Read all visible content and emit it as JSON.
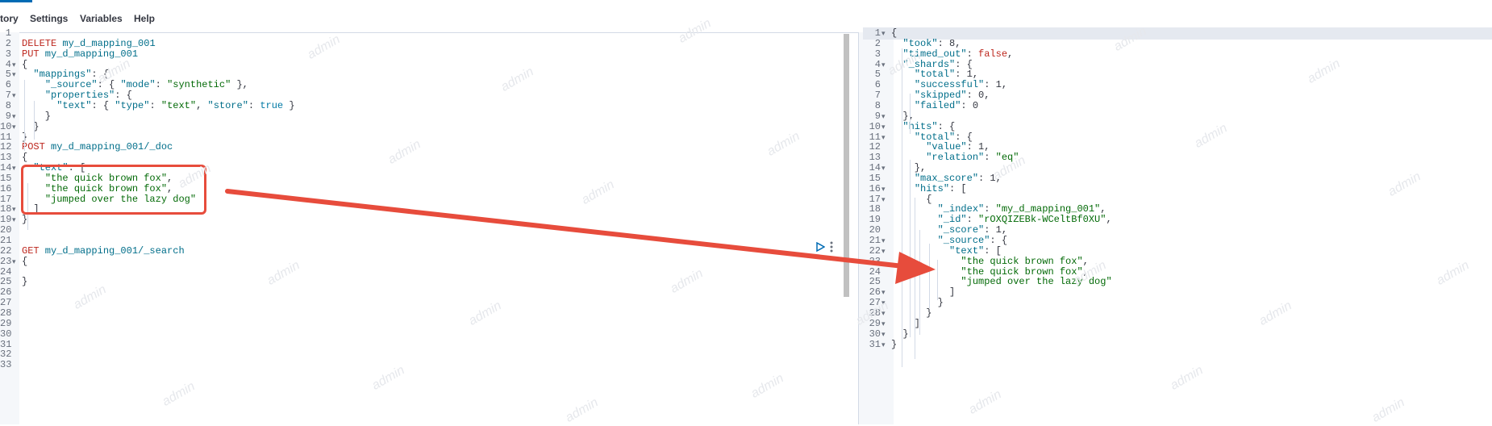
{
  "menu": {
    "history_label": "tory",
    "settings_label": "Settings",
    "variables_label": "Variables",
    "help_label": "Help"
  },
  "watermark_text": "admin",
  "request_editor": {
    "line_numbers": [
      "1",
      "2",
      "3",
      "4",
      "5",
      "6",
      "7",
      "8",
      "9",
      "10",
      "11",
      "12",
      "13",
      "14",
      "15",
      "16",
      "17",
      "18",
      "19",
      "20",
      "21",
      "22",
      "23",
      "24",
      "25",
      "26",
      "27",
      "28",
      "29",
      "30",
      "31",
      "32",
      "33"
    ],
    "fold_lines": [
      4,
      5,
      7,
      9,
      10,
      14,
      18,
      19,
      23
    ],
    "lines": [
      [],
      [
        {
          "t": "DELETE",
          "c": "kw"
        },
        {
          "t": " my_d_mapping_001",
          "c": "url"
        }
      ],
      [
        {
          "t": "PUT",
          "c": "kw"
        },
        {
          "t": " my_d_mapping_001",
          "c": "url"
        }
      ],
      [
        {
          "t": "{",
          "c": ""
        }
      ],
      [
        {
          "t": "  ",
          "c": ""
        },
        {
          "t": "\"mappings\"",
          "c": "key"
        },
        {
          "t": ": {",
          "c": ""
        }
      ],
      [
        {
          "t": "    ",
          "c": ""
        },
        {
          "t": "\"_source\"",
          "c": "key"
        },
        {
          "t": ": { ",
          "c": ""
        },
        {
          "t": "\"mode\"",
          "c": "key"
        },
        {
          "t": ": ",
          "c": ""
        },
        {
          "t": "\"synthetic\"",
          "c": "str"
        },
        {
          "t": " },",
          "c": ""
        }
      ],
      [
        {
          "t": "    ",
          "c": ""
        },
        {
          "t": "\"properties\"",
          "c": "key"
        },
        {
          "t": ": {",
          "c": ""
        }
      ],
      [
        {
          "t": "      ",
          "c": ""
        },
        {
          "t": "\"text\"",
          "c": "key"
        },
        {
          "t": ": { ",
          "c": ""
        },
        {
          "t": "\"type\"",
          "c": "key"
        },
        {
          "t": ": ",
          "c": ""
        },
        {
          "t": "\"text\"",
          "c": "str"
        },
        {
          "t": ", ",
          "c": ""
        },
        {
          "t": "\"store\"",
          "c": "key"
        },
        {
          "t": ": ",
          "c": ""
        },
        {
          "t": "true",
          "c": "lit"
        },
        {
          "t": " }",
          "c": ""
        }
      ],
      [
        {
          "t": "    }",
          "c": ""
        }
      ],
      [
        {
          "t": "  }",
          "c": ""
        }
      ],
      [
        {
          "t": "}",
          "c": ""
        }
      ],
      [
        {
          "t": "POST",
          "c": "kw"
        },
        {
          "t": " my_d_mapping_001/_doc",
          "c": "url"
        }
      ],
      [
        {
          "t": "{",
          "c": ""
        }
      ],
      [
        {
          "t": "  ",
          "c": ""
        },
        {
          "t": "\"text\"",
          "c": "key"
        },
        {
          "t": ": [",
          "c": ""
        }
      ],
      [
        {
          "t": "    ",
          "c": ""
        },
        {
          "t": "\"the quick brown fox\"",
          "c": "str"
        },
        {
          "t": ",",
          "c": ""
        }
      ],
      [
        {
          "t": "    ",
          "c": ""
        },
        {
          "t": "\"the quick brown fox\"",
          "c": "str"
        },
        {
          "t": ",",
          "c": ""
        }
      ],
      [
        {
          "t": "    ",
          "c": ""
        },
        {
          "t": "\"jumped over the lazy dog\"",
          "c": "str"
        }
      ],
      [
        {
          "t": "  ]",
          "c": ""
        }
      ],
      [
        {
          "t": "}",
          "c": ""
        }
      ],
      [],
      [],
      [
        {
          "t": "GET",
          "c": "kw"
        },
        {
          "t": " my_d_mapping_001/_search",
          "c": "url"
        }
      ],
      [
        {
          "t": "{",
          "c": ""
        }
      ],
      [],
      [
        {
          "t": "}",
          "c": ""
        }
      ],
      [],
      [],
      [],
      [],
      [],
      [],
      [],
      []
    ]
  },
  "response_editor": {
    "line_numbers": [
      "1",
      "2",
      "3",
      "4",
      "5",
      "6",
      "7",
      "8",
      "9",
      "10",
      "11",
      "12",
      "13",
      "14",
      "15",
      "16",
      "17",
      "18",
      "19",
      "20",
      "21",
      "22",
      "23",
      "24",
      "25",
      "26",
      "27",
      "28",
      "29",
      "30",
      "31"
    ],
    "fold_lines": [
      1,
      4,
      9,
      10,
      11,
      14,
      16,
      17,
      21,
      22,
      26,
      27,
      28,
      29,
      30,
      31
    ],
    "lines": [
      [
        {
          "t": "{",
          "c": ""
        }
      ],
      [
        {
          "t": "  ",
          "c": ""
        },
        {
          "t": "\"took\"",
          "c": "key"
        },
        {
          "t": ": ",
          "c": ""
        },
        {
          "t": "8",
          "c": "num"
        },
        {
          "t": ",",
          "c": ""
        }
      ],
      [
        {
          "t": "  ",
          "c": ""
        },
        {
          "t": "\"timed_out\"",
          "c": "key"
        },
        {
          "t": ": ",
          "c": ""
        },
        {
          "t": "false",
          "c": "kw"
        },
        {
          "t": ",",
          "c": ""
        }
      ],
      [
        {
          "t": "  ",
          "c": ""
        },
        {
          "t": "\"_shards\"",
          "c": "key"
        },
        {
          "t": ": {",
          "c": ""
        }
      ],
      [
        {
          "t": "    ",
          "c": ""
        },
        {
          "t": "\"total\"",
          "c": "key"
        },
        {
          "t": ": 1,",
          "c": ""
        }
      ],
      [
        {
          "t": "    ",
          "c": ""
        },
        {
          "t": "\"successful\"",
          "c": "key"
        },
        {
          "t": ": 1,",
          "c": ""
        }
      ],
      [
        {
          "t": "    ",
          "c": ""
        },
        {
          "t": "\"skipped\"",
          "c": "key"
        },
        {
          "t": ": 0,",
          "c": ""
        }
      ],
      [
        {
          "t": "    ",
          "c": ""
        },
        {
          "t": "\"failed\"",
          "c": "key"
        },
        {
          "t": ": 0",
          "c": ""
        }
      ],
      [
        {
          "t": "  },",
          "c": ""
        }
      ],
      [
        {
          "t": "  ",
          "c": ""
        },
        {
          "t": "\"hits\"",
          "c": "key"
        },
        {
          "t": ": {",
          "c": ""
        }
      ],
      [
        {
          "t": "    ",
          "c": ""
        },
        {
          "t": "\"total\"",
          "c": "key"
        },
        {
          "t": ": {",
          "c": ""
        }
      ],
      [
        {
          "t": "      ",
          "c": ""
        },
        {
          "t": "\"value\"",
          "c": "key"
        },
        {
          "t": ": 1,",
          "c": ""
        }
      ],
      [
        {
          "t": "      ",
          "c": ""
        },
        {
          "t": "\"relation\"",
          "c": "key"
        },
        {
          "t": ": ",
          "c": ""
        },
        {
          "t": "\"eq\"",
          "c": "str"
        }
      ],
      [
        {
          "t": "    },",
          "c": ""
        }
      ],
      [
        {
          "t": "    ",
          "c": ""
        },
        {
          "t": "\"max_score\"",
          "c": "key"
        },
        {
          "t": ": 1,",
          "c": ""
        }
      ],
      [
        {
          "t": "    ",
          "c": ""
        },
        {
          "t": "\"hits\"",
          "c": "key"
        },
        {
          "t": ": [",
          "c": ""
        }
      ],
      [
        {
          "t": "      {",
          "c": ""
        }
      ],
      [
        {
          "t": "        ",
          "c": ""
        },
        {
          "t": "\"_index\"",
          "c": "key"
        },
        {
          "t": ": ",
          "c": ""
        },
        {
          "t": "\"my_d_mapping_001\"",
          "c": "str"
        },
        {
          "t": ",",
          "c": ""
        }
      ],
      [
        {
          "t": "        ",
          "c": ""
        },
        {
          "t": "\"_id\"",
          "c": "key"
        },
        {
          "t": ": ",
          "c": ""
        },
        {
          "t": "\"rOXQIZEBk-WCeltBf0XU\"",
          "c": "str"
        },
        {
          "t": ",",
          "c": ""
        }
      ],
      [
        {
          "t": "        ",
          "c": ""
        },
        {
          "t": "\"_score\"",
          "c": "key"
        },
        {
          "t": ": 1,",
          "c": ""
        }
      ],
      [
        {
          "t": "        ",
          "c": ""
        },
        {
          "t": "\"_source\"",
          "c": "key"
        },
        {
          "t": ": {",
          "c": ""
        }
      ],
      [
        {
          "t": "          ",
          "c": ""
        },
        {
          "t": "\"text\"",
          "c": "key"
        },
        {
          "t": ": [",
          "c": ""
        }
      ],
      [
        {
          "t": "            ",
          "c": ""
        },
        {
          "t": "\"the quick brown fox\"",
          "c": "str"
        },
        {
          "t": ",",
          "c": ""
        }
      ],
      [
        {
          "t": "            ",
          "c": ""
        },
        {
          "t": "\"the quick brown fox\"",
          "c": "str"
        },
        {
          "t": ",",
          "c": ""
        }
      ],
      [
        {
          "t": "            ",
          "c": ""
        },
        {
          "t": "\"jumped over the lazy dog\"",
          "c": "str"
        }
      ],
      [
        {
          "t": "          ]",
          "c": ""
        }
      ],
      [
        {
          "t": "        }",
          "c": ""
        }
      ],
      [
        {
          "t": "      }",
          "c": ""
        }
      ],
      [
        {
          "t": "    ]",
          "c": ""
        }
      ],
      [
        {
          "t": "  }",
          "c": ""
        }
      ],
      [
        {
          "t": "}",
          "c": ""
        }
      ]
    ]
  },
  "colors": {
    "annotation_red": "#e74c3c",
    "accent": "#006bb4"
  },
  "icons": {
    "run": "play-icon",
    "actions": "wrench-icon"
  }
}
